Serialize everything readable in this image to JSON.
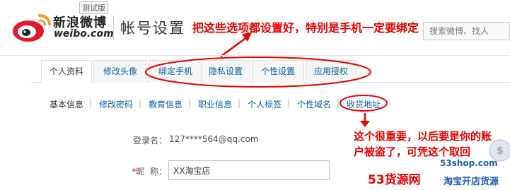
{
  "header": {
    "beta_label": "测试版",
    "brand_cn": "新浪微博",
    "brand_en": "weibo.com",
    "page_title": "帐号设置",
    "search_placeholder": "搜索微博、找人"
  },
  "annotations": {
    "top": "把这些选项都设置好，特别是手机一定要绑定",
    "right": "这个很重要，以后要是你的账户被盗了，可凭这个取回"
  },
  "tabs": [
    {
      "label": "个人资料",
      "active": true
    },
    {
      "label": "修改头像"
    },
    {
      "label": "绑定手机"
    },
    {
      "label": "隐私设置"
    },
    {
      "label": "个性设置"
    },
    {
      "label": "应用授权"
    }
  ],
  "subnav": [
    {
      "label": "基本信息",
      "current": true
    },
    {
      "label": "修改密码"
    },
    {
      "label": "教育信息"
    },
    {
      "label": "职业信息"
    },
    {
      "label": "个人标签"
    },
    {
      "label": "个性域名"
    },
    {
      "label": "收货地址"
    }
  ],
  "form": {
    "login_label": "登录名：",
    "login_value": "127****564@qq.com",
    "nick_required": "*",
    "nick_label": "昵  称：",
    "nick_value": "XX淘宝店"
  },
  "watermark": {
    "big": "53货源网",
    "site": "53shop.com",
    "cn": "淘宝开店货源"
  },
  "colors": {
    "annotation": "#e60000",
    "link": "#0a5e9c",
    "watermark_blue": "#1c5db3"
  }
}
